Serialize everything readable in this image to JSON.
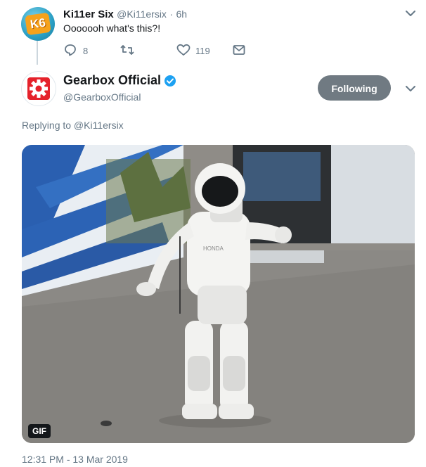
{
  "reply_tweet": {
    "display_name": "Ki11er Six",
    "handle": "@Ki11ersix",
    "separator": "·",
    "time": "6h",
    "text": "Ooooooh what's this?!",
    "avatar_text": "K6",
    "reply_count": "8",
    "retweet_count": "",
    "like_count": "119"
  },
  "main_tweet": {
    "display_name": "Gearbox Official",
    "handle": "@GearboxOfficial",
    "follow_button_label": "Following",
    "replying_to": "Replying to @Ki11ersix",
    "media_badge": "GIF",
    "timestamp": "12:31 PM - 13 Mar 2019"
  },
  "icons": [
    "reply-icon",
    "retweet-icon",
    "like-icon",
    "message-icon",
    "chevron-down-icon",
    "verified-badge-icon",
    "gear-logo-icon"
  ],
  "colors": {
    "verified_blue": "#1da1f2",
    "gearbox_red": "#e5222b",
    "following_button": "#707a82",
    "muted_text": "#657786"
  }
}
